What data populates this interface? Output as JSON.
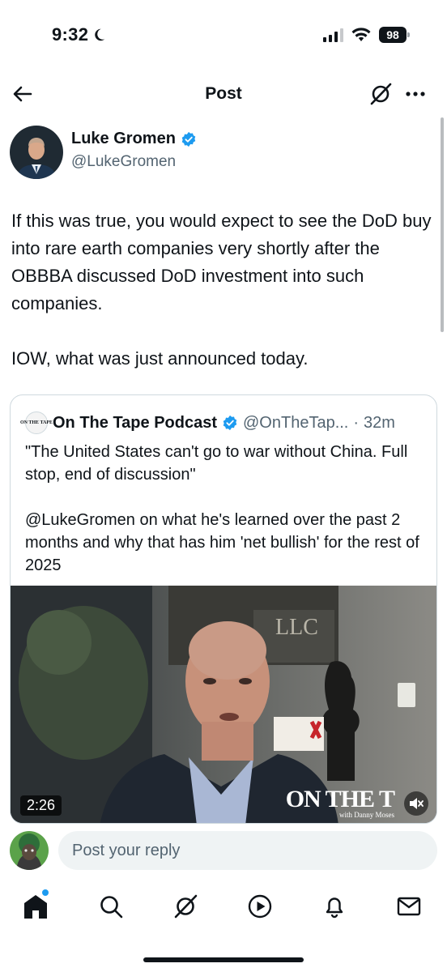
{
  "status_bar": {
    "time": "9:32",
    "battery": "98"
  },
  "nav": {
    "title": "Post"
  },
  "post": {
    "author_name": "Luke Gromen",
    "author_handle": "@LukeGromen",
    "paragraphs": [
      "If this was true, you would expect to see the DoD buy into rare earth companies very shortly after the OBBBA discussed DoD investment into such companies.",
      "IOW, what was just announced today."
    ]
  },
  "quoted_post": {
    "avatar_text": "ON THE TAPE",
    "author_name": "On The Tape Podcast",
    "author_handle": "@OnTheTap...",
    "separator": "·",
    "time": "32m",
    "paragraphs": [
      "\"The United States can't go to war without China. Full stop, end of discussion\"",
      "@LukeGromen on what he's learned over the past 2 months and why that has him 'net bullish' for the rest of 2025"
    ],
    "video": {
      "duration": "2:26",
      "watermark": "ON THE T",
      "watermark_sub": "with Danny Moses",
      "wall_sign": "LLC"
    }
  },
  "reply": {
    "placeholder": "Post your reply"
  },
  "tabs": [
    "home",
    "search",
    "grok",
    "video",
    "notifications",
    "messages"
  ],
  "colors": {
    "accent": "#1d9bf0",
    "text": "#0f1419",
    "secondary": "#536471",
    "border": "#cfd9de"
  },
  "icons": {
    "back": "arrow-left-icon",
    "grok": "grok-icon",
    "more": "more-dots-icon",
    "verified": "verified-badge-icon",
    "mute": "speaker-muted-icon"
  }
}
